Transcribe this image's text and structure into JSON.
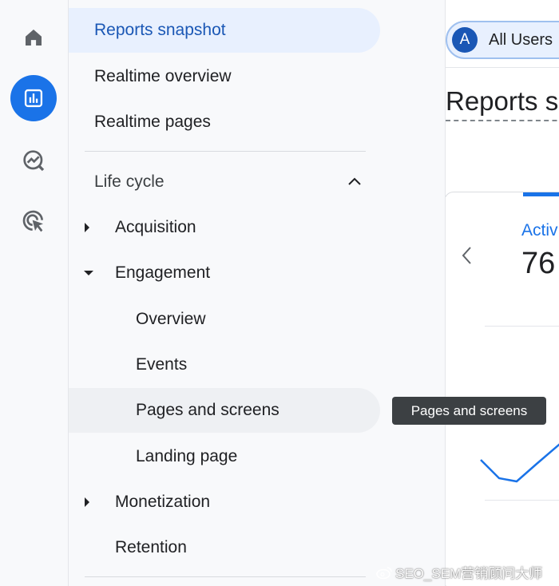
{
  "rail": {
    "items": [
      {
        "name": "home",
        "icon": "home-icon"
      },
      {
        "name": "reports",
        "icon": "bar-chart-icon",
        "active": true
      },
      {
        "name": "explore",
        "icon": "explore-icon"
      },
      {
        "name": "advertising",
        "icon": "advertising-icon"
      }
    ]
  },
  "nav": {
    "reports_snapshot": "Reports snapshot",
    "realtime_overview": "Realtime overview",
    "realtime_pages": "Realtime pages",
    "section_label": "Life cycle",
    "acquisition": "Acquisition",
    "engagement": "Engagement",
    "overview": "Overview",
    "events": "Events",
    "pages_and_screens": "Pages and screens",
    "landing_page": "Landing page",
    "monetization": "Monetization",
    "retention": "Retention"
  },
  "header": {
    "avatar_letter": "A",
    "user_chip_label": "All Users",
    "page_title": "Reports s"
  },
  "card": {
    "metric_label": "Activ",
    "metric_value": "76"
  },
  "tooltip": {
    "text": "Pages and screens"
  },
  "watermark": {
    "text": "SEO_SEM营销顾问大师"
  },
  "colors": {
    "accent": "#1a73e8",
    "selected_bg": "#e8f0fe",
    "selected_text": "#1a57b5",
    "tooltip_bg": "#3c4043"
  }
}
